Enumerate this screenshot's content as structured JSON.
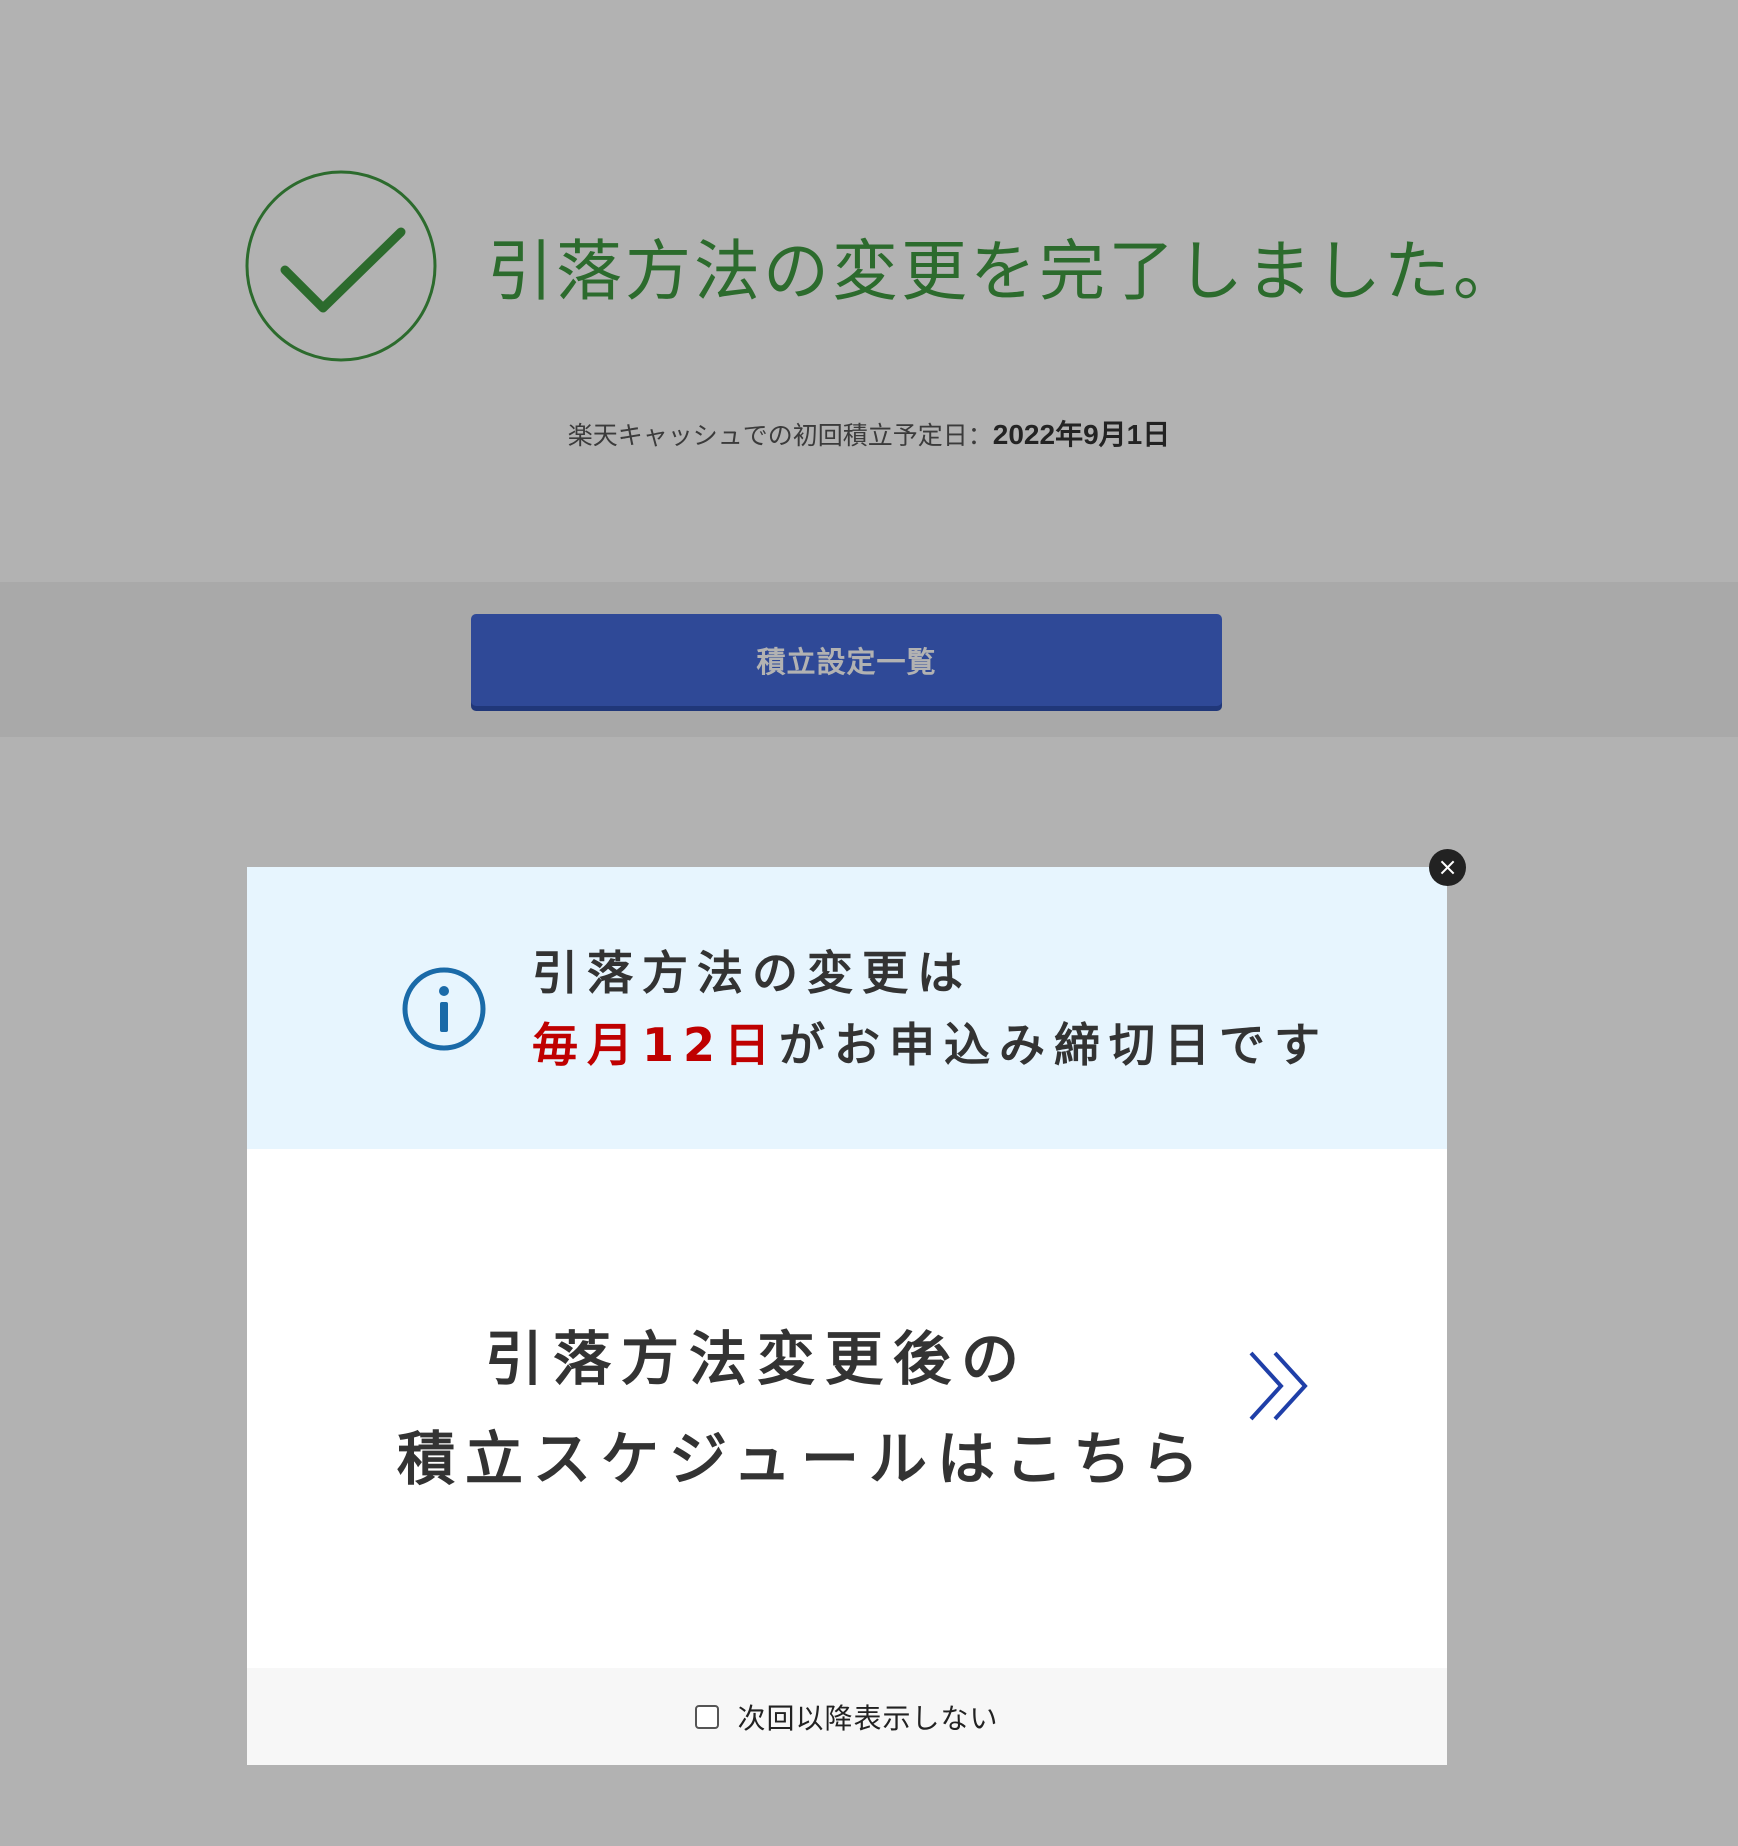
{
  "page": {
    "complete_title": "引落方法の変更を完了しました。",
    "schedule_label": "楽天キャッシュでの初回積立予定日：",
    "schedule_date": "2022年9月1日",
    "primary_button_label": "積立設定一覧"
  },
  "modal": {
    "info_line1": "引落方法の変更は",
    "info_deadline": "毎月12日",
    "info_line2_rest": "がお申込み締切日です",
    "link_line1": "引落方法変更後の",
    "link_line2": "積立スケジュールはこちら",
    "dont_show_label": "次回以降表示しない",
    "dont_show_checked": false,
    "close_symbol": "×"
  },
  "icons": {
    "check": "check-circle-icon",
    "info": "info-icon",
    "chevron": "double-chevron-right-icon",
    "close": "close-icon"
  },
  "colors": {
    "success_green": "#3f9a41",
    "primary_blue": "#4469d8",
    "info_band": "#e7f5fe",
    "deadline_red": "#bf0000",
    "chevron_blue": "#1f3fa8"
  }
}
